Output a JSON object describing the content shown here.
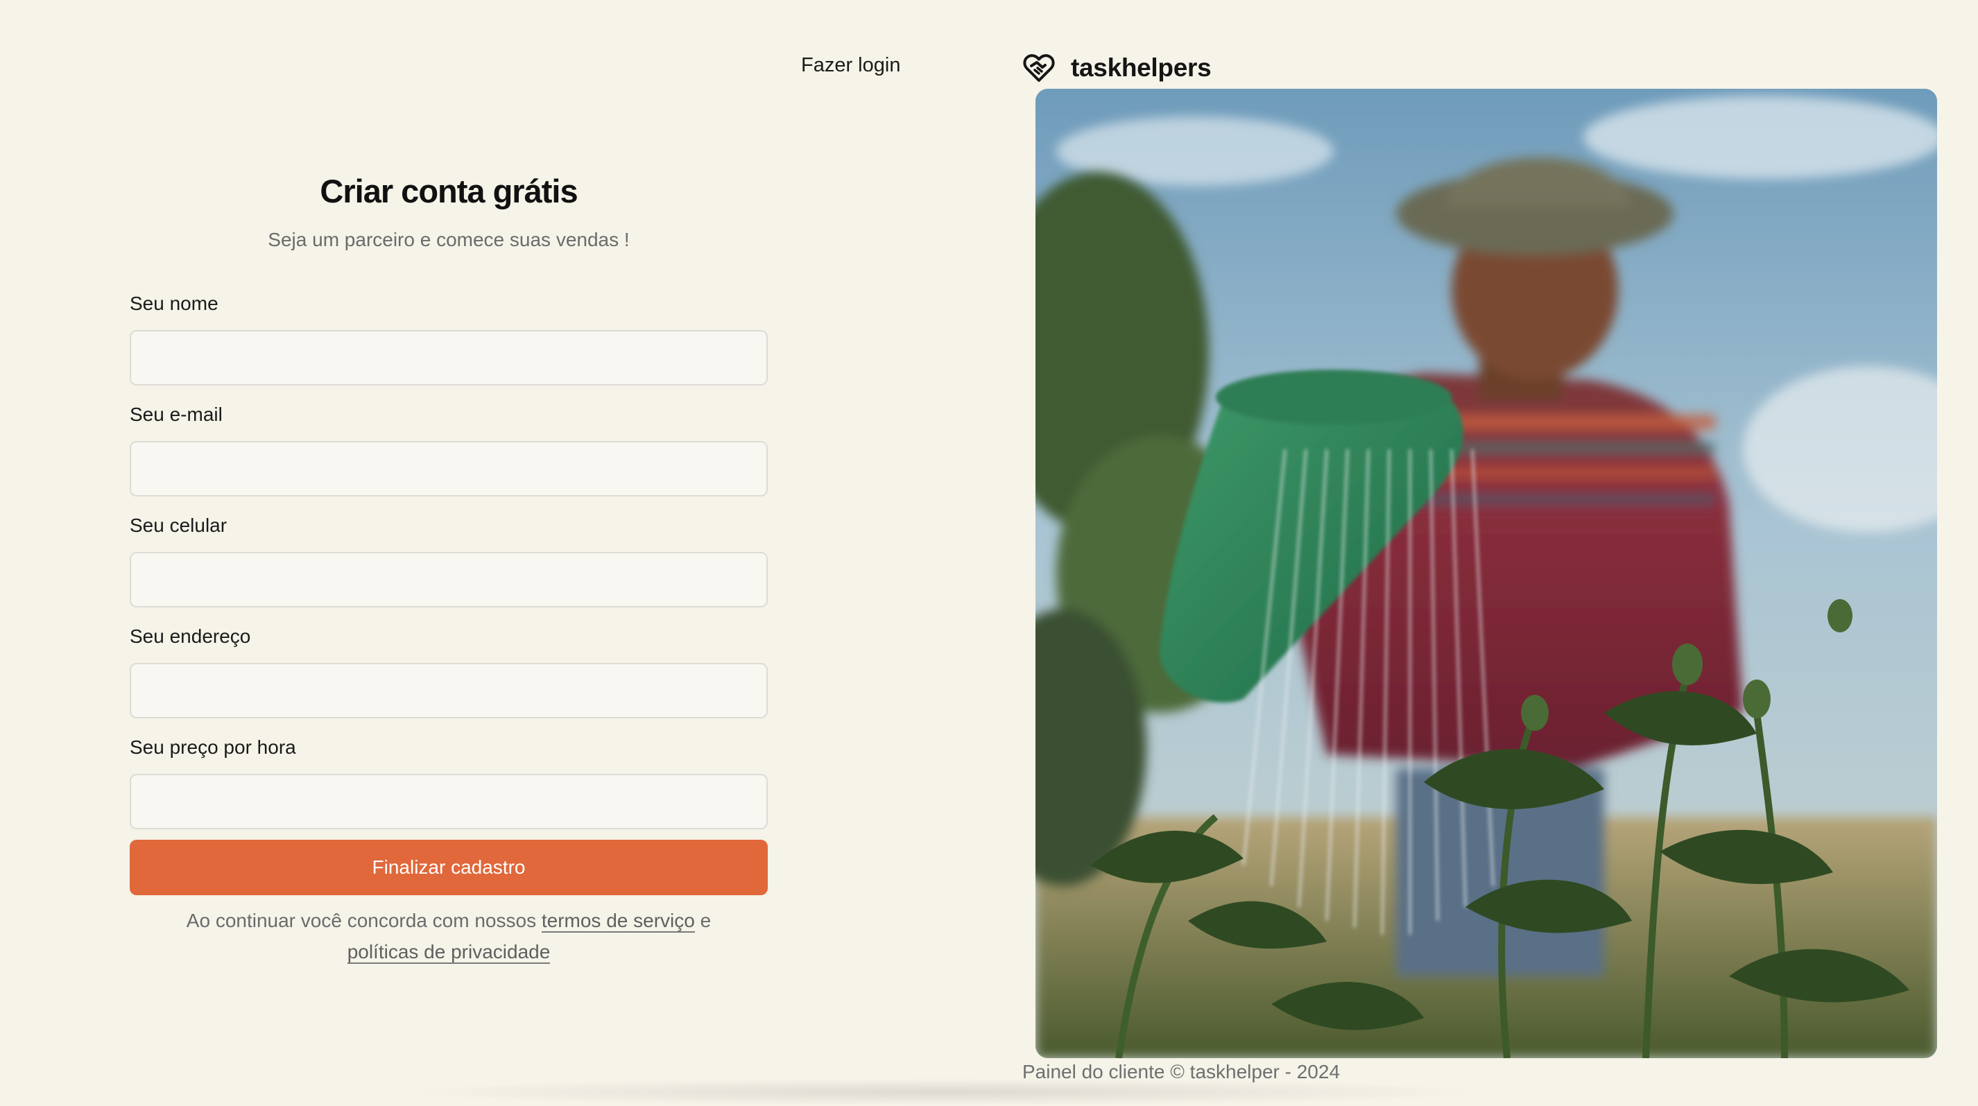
{
  "header": {
    "login_link": "Fazer login"
  },
  "brand": {
    "name": "taskhelpers",
    "logo_icon": "heart-handshake-icon"
  },
  "form": {
    "title": "Criar conta grátis",
    "subtitle": "Seja um parceiro e comece suas vendas !",
    "fields": [
      {
        "label": "Seu nome",
        "value": "",
        "placeholder": ""
      },
      {
        "label": "Seu e-mail",
        "value": "",
        "placeholder": ""
      },
      {
        "label": "Seu celular",
        "value": "",
        "placeholder": ""
      },
      {
        "label": "Seu endereço",
        "value": "",
        "placeholder": ""
      },
      {
        "label": "Seu preço por hora",
        "value": "",
        "placeholder": ""
      }
    ],
    "submit_label": "Finalizar cadastro",
    "legal": {
      "prefix": "Ao continuar você concorda com nossos",
      "terms_link": "termos de serviço",
      "connector": "e",
      "privacy_link": "políticas de privacidade"
    }
  },
  "hero": {
    "image_alt": "Person watering plants with a green watering can"
  },
  "footer": {
    "text": "Painel do cliente © taskhelper - 2024"
  },
  "colors": {
    "background": "#f6f3e9",
    "accent": "#e0683b",
    "input_border": "#dcdbd4",
    "muted_text": "#6b6b6b"
  }
}
